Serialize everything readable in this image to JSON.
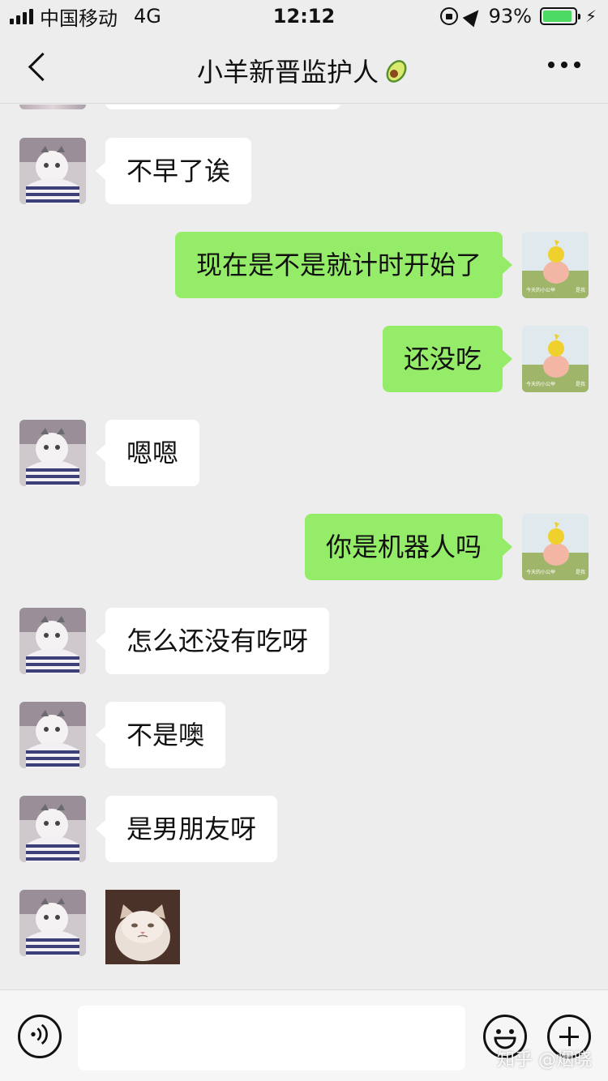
{
  "status_bar": {
    "carrier": "中国移动",
    "network": "4G",
    "time": "12:12",
    "battery_percent": "93%",
    "battery_level": 0.93,
    "battery_color": "#4cd964"
  },
  "nav": {
    "title": "小羊新晋监护人",
    "title_icon": "avocado-icon",
    "back_icon": "chevron-left-icon",
    "more_icon": "more-dots-icon"
  },
  "messages": [
    {
      "side": "in",
      "text": "不早了诶"
    },
    {
      "side": "out",
      "text": "现在是不是就计时开始了"
    },
    {
      "side": "out",
      "text": "还没吃"
    },
    {
      "side": "in",
      "text": "嗯嗯"
    },
    {
      "side": "out",
      "text": "你是机器人吗"
    },
    {
      "side": "in",
      "text": "怎么还没有吃呀"
    },
    {
      "side": "in",
      "text": "不是噢"
    },
    {
      "side": "in",
      "text": "是男朋友呀"
    },
    {
      "side": "in",
      "type": "sticker",
      "sticker_icon": "grumpy-cat-sticker"
    }
  ],
  "avatars": {
    "contact": "cat-avatar",
    "self": "yellow-doll-avatar",
    "self_caption_left": "今天的小公举",
    "self_caption_right": "是我"
  },
  "input_bar": {
    "voice_icon": "voice-icon",
    "input_value": "",
    "emoji_icon": "emoji-icon",
    "plus_icon": "plus-icon"
  },
  "colors": {
    "background": "#ededed",
    "outgoing_bubble": "#95ec69",
    "incoming_bubble": "#ffffff"
  },
  "watermark": "知乎 @烟晓"
}
